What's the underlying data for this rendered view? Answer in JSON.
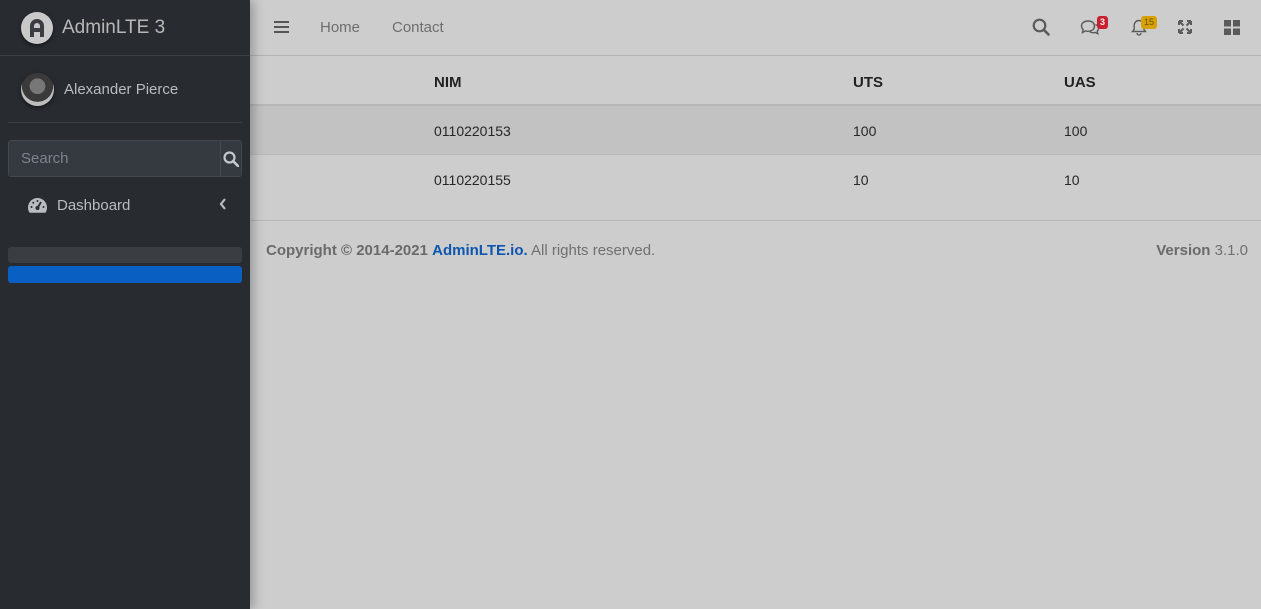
{
  "brand": {
    "title": "AdminLTE 3"
  },
  "user": {
    "name": "Alexander Pierce"
  },
  "search": {
    "placeholder": "Search"
  },
  "sidebar": {
    "items": [
      {
        "label": "Dashboard",
        "icon": "tachometer-icon"
      }
    ]
  },
  "navbar": {
    "links": [
      {
        "label": "Home"
      },
      {
        "label": "Contact"
      }
    ],
    "messages_badge": "3",
    "notifications_badge": "15"
  },
  "table": {
    "headers": [
      "NIM",
      "UTS",
      "UAS"
    ],
    "rows": [
      [
        "0110220153",
        "100",
        "100"
      ],
      [
        "0110220155",
        "10",
        "10"
      ]
    ]
  },
  "footer": {
    "copyright_prefix": "Copyright © 2014-2021",
    "copyright_link": "AdminLTE.io.",
    "copyright_suffix": "All rights reserved.",
    "version_label": "Version",
    "version_value": "3.1.0"
  },
  "colors": {
    "sidebar_bg": "#282c31",
    "accent_blue": "#0a5fc2",
    "messages_badge": "#c8202f",
    "notifications_badge": "#d7a100"
  }
}
